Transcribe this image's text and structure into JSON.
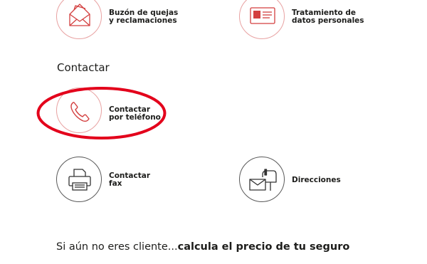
{
  "top_items": [
    {
      "line1": "Buzón de quejas",
      "line2": "y reclamaciones",
      "icon": "mail-envelope-icon"
    },
    {
      "line1": "Tratamiento de",
      "line2": "datos personales",
      "icon": "id-card-icon"
    }
  ],
  "section": {
    "title": "Contactar"
  },
  "contact_items": [
    {
      "line1": "Contactar",
      "line2": "por teléfono",
      "icon": "phone-icon"
    },
    {
      "line1": "Contactar",
      "line2": "fax",
      "icon": "fax-icon"
    },
    {
      "line1": "Direcciones",
      "icon": "mailbox-icon"
    }
  ],
  "footer": {
    "prefix": "Si aún no eres cliente...",
    "link": "calcula el precio de tu seguro"
  },
  "colors": {
    "brand_red": "#d33f3f",
    "circle_red": "#e8a2a2",
    "highlight": "#e3001b",
    "text": "#1d1d1b"
  }
}
